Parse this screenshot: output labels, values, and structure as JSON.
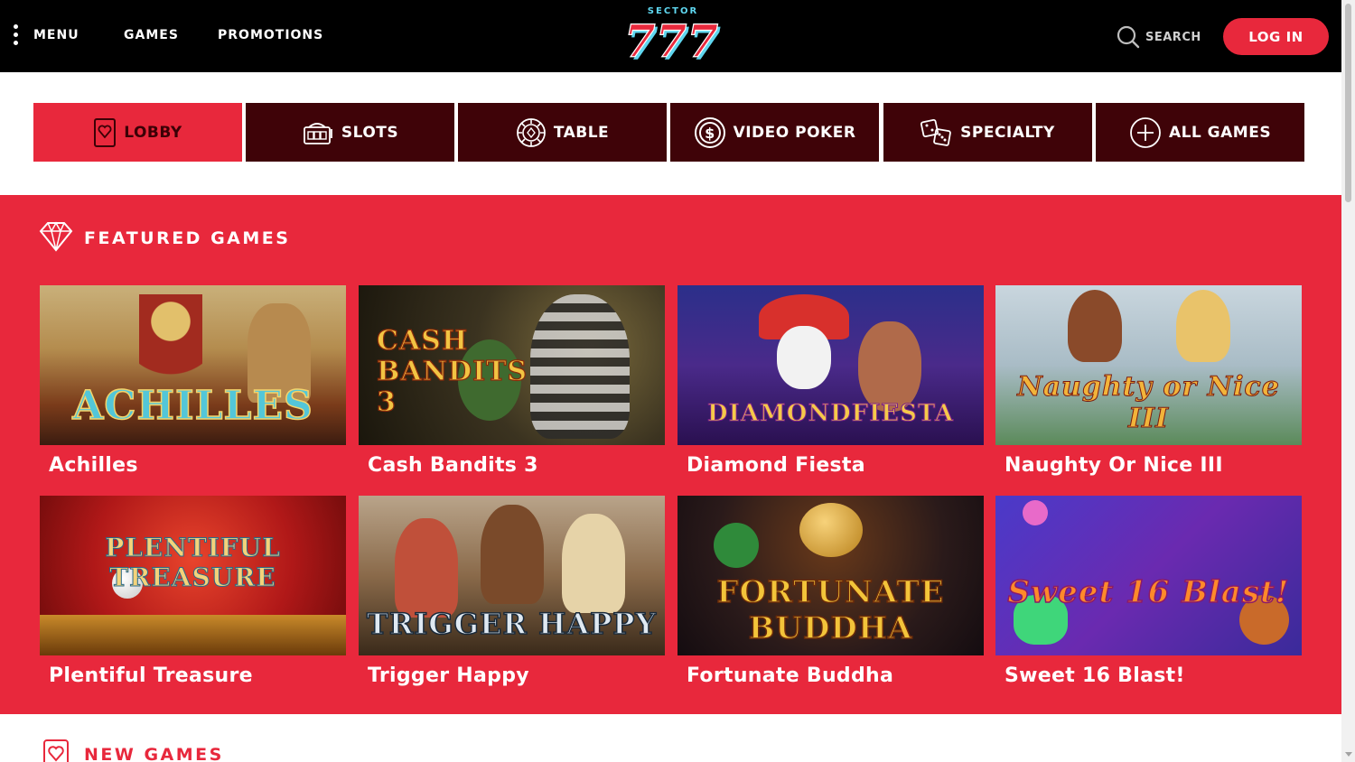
{
  "header": {
    "menu_label": "MENU",
    "games_label": "GAMES",
    "promotions_label": "PROMOTIONS",
    "logo_top": "SECTOR",
    "logo_main": "777",
    "search_label": "SEARCH",
    "login_label": "LOG IN"
  },
  "tabs": [
    {
      "label": "LOBBY",
      "icon": "heart-card-icon",
      "active": true
    },
    {
      "label": "SLOTS",
      "icon": "slot-machine-icon",
      "active": false
    },
    {
      "label": "TABLE",
      "icon": "poker-chip-icon",
      "active": false
    },
    {
      "label": "VIDEO POKER",
      "icon": "dollar-coin-icon",
      "active": false
    },
    {
      "label": "SPECIALTY",
      "icon": "dice-icon",
      "active": false
    },
    {
      "label": "ALL GAMES",
      "icon": "plus-circle-icon",
      "active": false
    }
  ],
  "featured": {
    "title": "FEATURED GAMES",
    "games": [
      {
        "name": "Achilles",
        "art_text": "ACHILLES"
      },
      {
        "name": "Cash Bandits 3",
        "art_text": "CASH BANDITS 3"
      },
      {
        "name": "Diamond Fiesta",
        "art_text": "DIAMONDFIESTA"
      },
      {
        "name": "Naughty Or Nice III",
        "art_text": "Naughty or Nice III"
      },
      {
        "name": "Plentiful Treasure",
        "art_text": "PLENTIFUL TREASURE"
      },
      {
        "name": "Trigger Happy",
        "art_text": "TRIGGER HAPPY"
      },
      {
        "name": "Fortunate Buddha",
        "art_text": "FORTUNATE BUDDHA"
      },
      {
        "name": "Sweet 16 Blast!",
        "art_text": "Sweet 16 Blast!"
      }
    ]
  },
  "new_games": {
    "title": "NEW GAMES"
  },
  "colors": {
    "accent": "#e8283c",
    "tab_bg": "#3f0308",
    "header_bg": "#000000"
  }
}
